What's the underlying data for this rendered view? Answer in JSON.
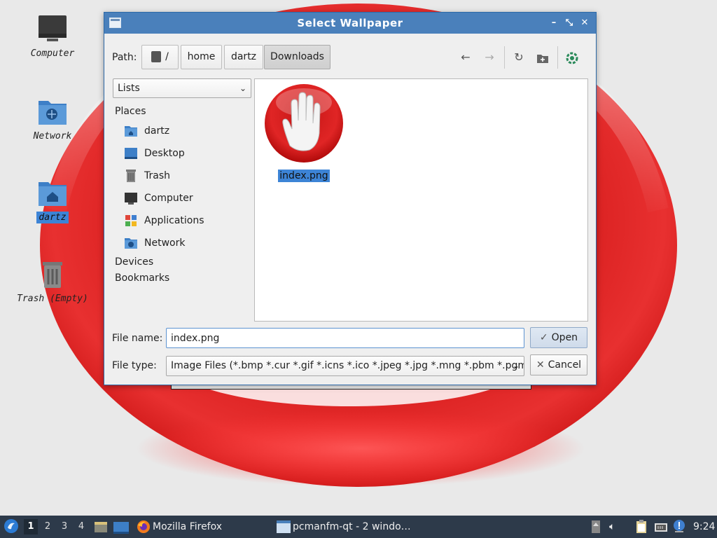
{
  "desktop": {
    "icons": [
      {
        "label": "Computer"
      },
      {
        "label": "Network"
      },
      {
        "label": "dartz"
      },
      {
        "label": "Trash (Empty)"
      }
    ]
  },
  "dialog": {
    "title": "Select Wallpaper",
    "path_label": "Path:",
    "crumbs": [
      "/",
      "home",
      "dartz",
      "Downloads"
    ],
    "view_mode": "Lists",
    "places_heading": "Places",
    "places": [
      "dartz",
      "Desktop",
      "Trash",
      "Computer",
      "Applications",
      "Network"
    ],
    "devices_heading": "Devices",
    "bookmarks_heading": "Bookmarks",
    "files": [
      {
        "name": "index.png"
      }
    ],
    "file_name_label": "File name:",
    "file_name_value": "index.png",
    "file_type_label": "File type:",
    "file_type_value": "Image Files (*.bmp *.cur *.gif *.icns *.ico *.jpeg *.jpg *.mng *.pbm *.pgm",
    "open_label": "Open",
    "cancel_label": "Cancel"
  },
  "taskbar": {
    "workspaces": [
      "1",
      "2",
      "3",
      "4"
    ],
    "tasks": [
      "Mozilla Firefox",
      "pcmanfm-qt - 2 windo…"
    ],
    "clock": "9:24"
  },
  "colors": {
    "titlebar": "#4a80bb",
    "selection": "#3d84d6",
    "taskbar": "#2d3a4a",
    "wallpaper_red": "#d81e1e"
  }
}
